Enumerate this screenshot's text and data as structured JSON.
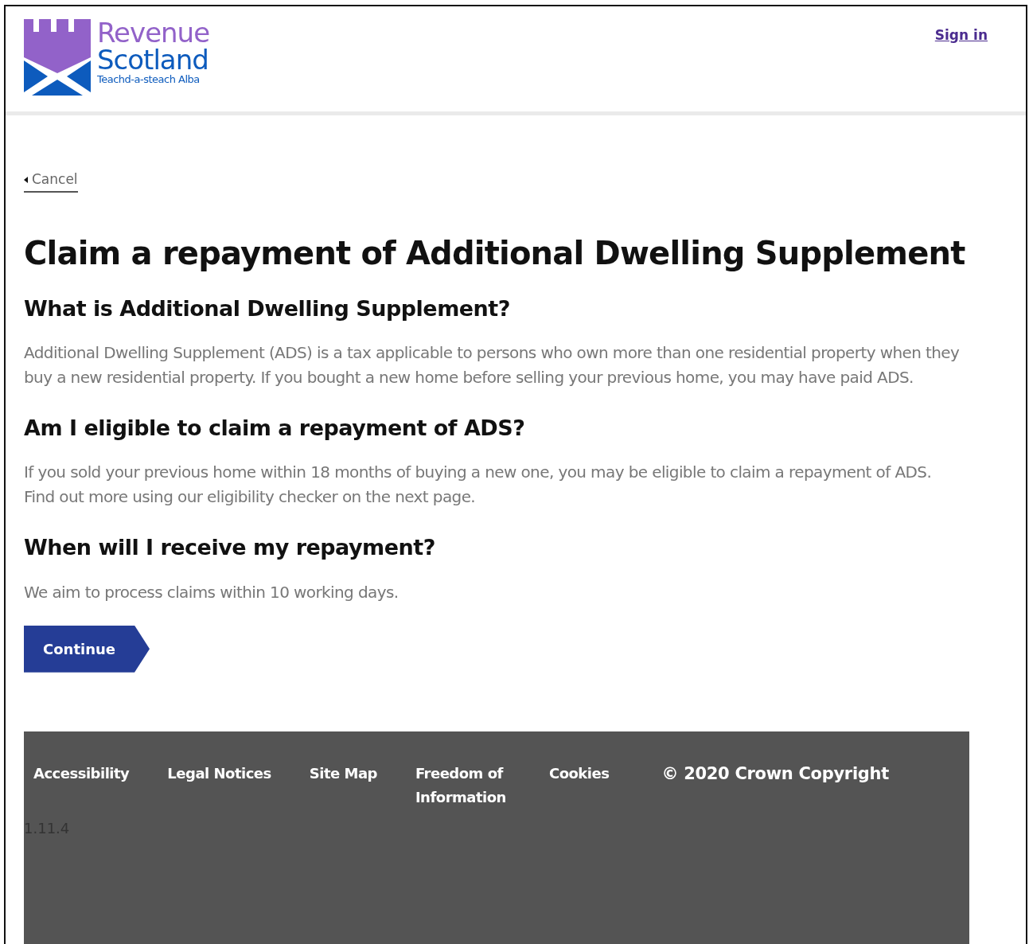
{
  "header": {
    "logo": {
      "line1": "Revenue",
      "line2": "Scotland",
      "tagline": "Teachd-a-steach Alba"
    },
    "sign_in": "Sign in"
  },
  "back_link": "Cancel",
  "title": "Claim a repayment of Additional Dwelling Supplement",
  "sections": [
    {
      "heading": "What is Additional Dwelling Supplement?",
      "body": "Additional Dwelling Supplement (ADS) is a tax applicable to persons who own more than one residential property when they buy a new residential property. If you bought a new home before selling your previous home, you may have paid ADS."
    },
    {
      "heading": "Am I eligible to claim a repayment of ADS?",
      "body": "If you sold your previous home within 18 months of buying a new one, you may be eligible to claim a repayment of ADS. Find out more using our eligibility checker on the next page."
    },
    {
      "heading": "When will I receive my repayment?",
      "body": "We aim to process claims within 10 working days."
    }
  ],
  "continue_button": "Continue",
  "footer": {
    "links": [
      "Accessibility",
      "Legal Notices",
      "Site Map",
      "Freedom of Information",
      "Cookies"
    ],
    "copyright": "© 2020 Crown Copyright",
    "version": "1.11.4"
  }
}
